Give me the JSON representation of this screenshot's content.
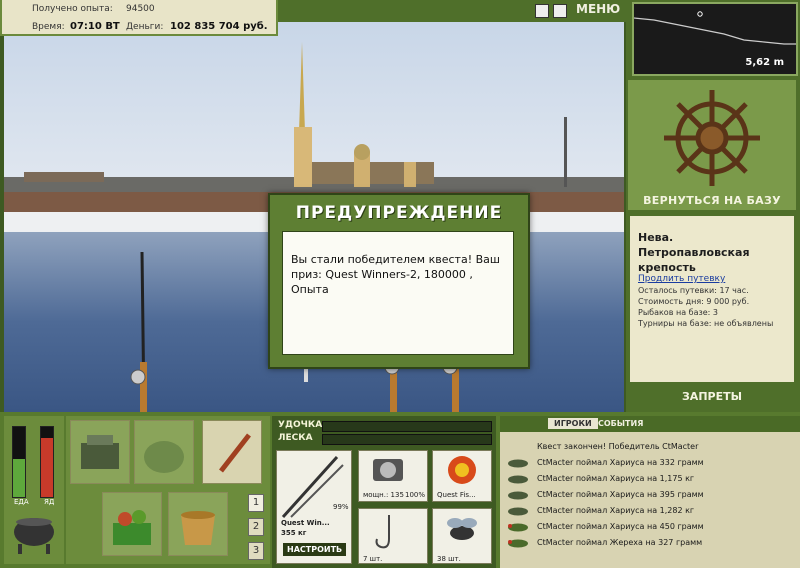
{
  "info": {
    "exp_label": "Получено опыта:",
    "exp_value": "94500",
    "time_label": "Время:",
    "time_value": "07:10 ВТ",
    "money_label": "Деньги:",
    "money_value": "102 835 704 руб."
  },
  "topbar": {
    "menu_label": "МЕНЮ"
  },
  "depth": {
    "value": "5,62 m"
  },
  "right": {
    "return_label": "ВЕРНУТЬСЯ НА БАЗУ",
    "location_title": "Нева. Петропавловская крепость",
    "extend_link": "Продлить путевку",
    "lines": [
      "Осталось путевки: 17 час.",
      "Стоимость дня: 9 000 руб.",
      "Рыбаков на базе: 3",
      "Турниры на базе: не объявлены"
    ],
    "bans_label": "ЗАПРЕТЫ"
  },
  "dialog": {
    "title": "ПРЕДУПРЕЖДЕНИЕ",
    "message": "Вы стали победителем квеста! Ваш приз: Quest Winners-2, 180000 , Опыта"
  },
  "meters": {
    "food_label": "ЕДА",
    "poison_label": "ЯД",
    "food_level": 0.55,
    "poison_level": 0.85
  },
  "inventory": {
    "pages": [
      "1",
      "2",
      "3"
    ]
  },
  "tackle": {
    "rod_label": "УДОЧКА",
    "line_label": "ЛЕСКА",
    "rod_name": "Quest Win...",
    "rod_weight": "355 кг",
    "rod_pct": "99%",
    "reel_caption": "мощн.: 135",
    "reel_pct": "100%",
    "lure_caption": "Quest Fis...",
    "hook_caption": "7 шт.",
    "bait_caption": "38 шт.",
    "setup_label": "НАСТРОИТЬ"
  },
  "events": {
    "tab_players": "ИГРОКИ",
    "tab_events": "СОБЫТИЯ",
    "items": [
      "Квест закончен! Победитель CtMacter",
      "CtMacter поймал Хариуса на 332 грамм",
      "CtMacter поймал Хариуса на 1,175 кг",
      "CtMacter поймал Хариуса на 395 грамм",
      "CtMacter поймал Хариуса на 1,282 кг",
      "CtMacter поймал Хариуса на 450 грамм",
      "CtMacter поймал Жереха на 327 грамм"
    ]
  }
}
